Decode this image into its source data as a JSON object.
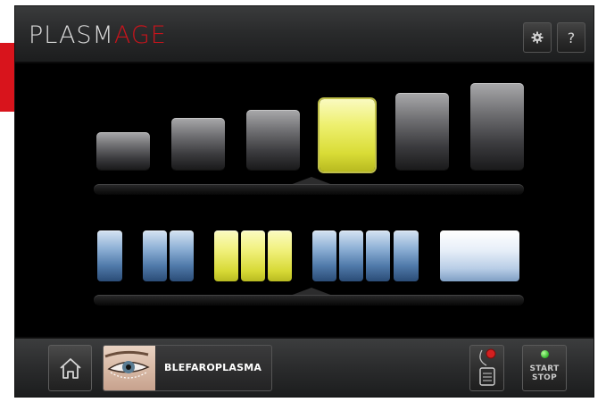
{
  "header": {
    "logo_part1": "PLASM",
    "logo_part2": "AGE",
    "settings_icon": "gear-icon",
    "help_label": "?"
  },
  "selectors": {
    "top_row": {
      "count": 6,
      "selected_index": 3
    },
    "bottom_row": {
      "count": 11,
      "selected_indices": [
        3,
        4,
        5
      ]
    }
  },
  "footer": {
    "home_icon": "home-icon",
    "procedure_label": "BLEFAROPLASMA",
    "start_line1": "START",
    "start_line2": "STOP"
  },
  "colors": {
    "brand_red": "#c7141c",
    "selected_yellow": "#e8ea5a",
    "tile_blue": "#4f79a9"
  }
}
